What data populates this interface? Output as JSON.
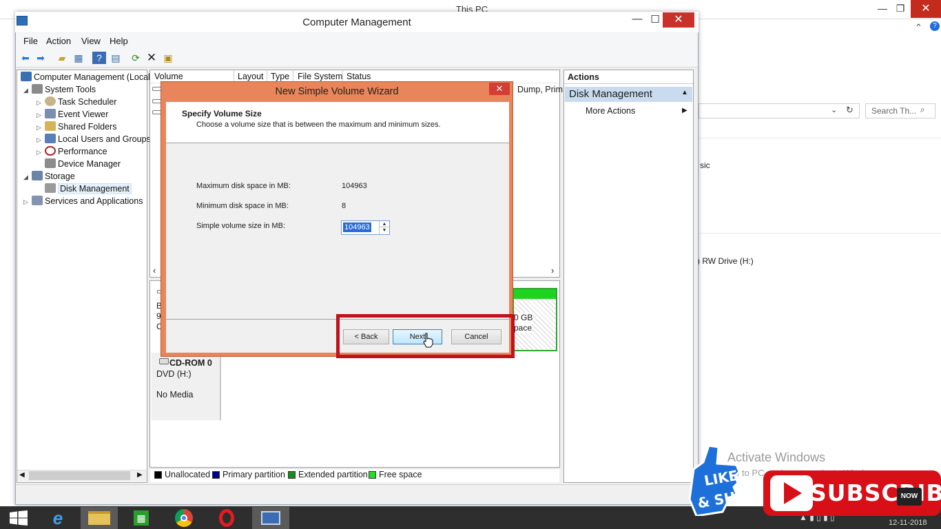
{
  "background_window": {
    "title": "This PC",
    "search_placeholder": "Search Th...",
    "partial_text_1": "sic",
    "partial_text_2": ") RW Drive (H:)",
    "activate_title": "Activate Windows",
    "activate_sub": "Go to PC settings to activate Windows."
  },
  "window": {
    "title": "Computer Management",
    "controls": {
      "minimize": "—",
      "maximize": "☐",
      "close": "✕"
    }
  },
  "menu": [
    "File",
    "Action",
    "View",
    "Help"
  ],
  "tree": {
    "items": [
      {
        "label": "Computer Management (Local",
        "level": 0,
        "expander": ""
      },
      {
        "label": "System Tools",
        "level": 1,
        "expander": "◢"
      },
      {
        "label": "Task Scheduler",
        "level": 2,
        "expander": "▷"
      },
      {
        "label": "Event Viewer",
        "level": 2,
        "expander": "▷"
      },
      {
        "label": "Shared Folders",
        "level": 2,
        "expander": "▷"
      },
      {
        "label": "Local Users and Groups",
        "level": 2,
        "expander": "▷"
      },
      {
        "label": "Performance",
        "level": 2,
        "expander": "▷"
      },
      {
        "label": "Device Manager",
        "level": 2,
        "expander": ""
      },
      {
        "label": "Storage",
        "level": 1,
        "expander": "◢"
      },
      {
        "label": "Disk Management",
        "level": 2,
        "expander": "",
        "selected": true
      },
      {
        "label": "Services and Applications",
        "level": 1,
        "expander": "▷"
      }
    ]
  },
  "volume_list": {
    "columns": [
      "Volume",
      "Layout",
      "Type",
      "File System",
      "Status"
    ],
    "partial_status": "Dump, Prim"
  },
  "disk_area": {
    "cdrom_title": "CD-ROM 0",
    "cdrom_drive": "DVD (H:)",
    "cdrom_media": "No Media",
    "partial_left": [
      "B",
      "9",
      "C"
    ],
    "free_size": "0 GB",
    "free_label": "pace"
  },
  "legend": [
    {
      "label": "Unallocated",
      "color": "#000000"
    },
    {
      "label": "Primary partition",
      "color": "#00008b"
    },
    {
      "label": "Extended partition",
      "color": "#1a8a1a"
    },
    {
      "label": "Free space",
      "color": "#22dd22"
    }
  ],
  "actions": {
    "header": "Actions",
    "section": "Disk Management",
    "more": "More Actions"
  },
  "wizard": {
    "title": "New Simple Volume Wizard",
    "close": "✕",
    "heading": "Specify Volume Size",
    "subheading": "Choose a volume size that is between the maximum and minimum sizes.",
    "max_label": "Maximum disk space in MB:",
    "max_value": "104963",
    "min_label": "Minimum disk space in MB:",
    "min_value": "8",
    "size_label": "Simple volume size in MB:",
    "size_value": "104963",
    "back_label": "< Back",
    "next_label": "Next",
    "cancel_label": "Cancel"
  },
  "taskbar": {
    "date": "12-11-2018"
  },
  "overlay": {
    "like_share": [
      "LIKE",
      "& SHARE"
    ],
    "subscribe": "SUBSCRIBE",
    "now": "NOW"
  },
  "colors": {
    "wizard_frame": "#e8855a",
    "highlight": "#c1121c",
    "selection": "#2a6ad7",
    "subscribe": "#d90f18"
  }
}
